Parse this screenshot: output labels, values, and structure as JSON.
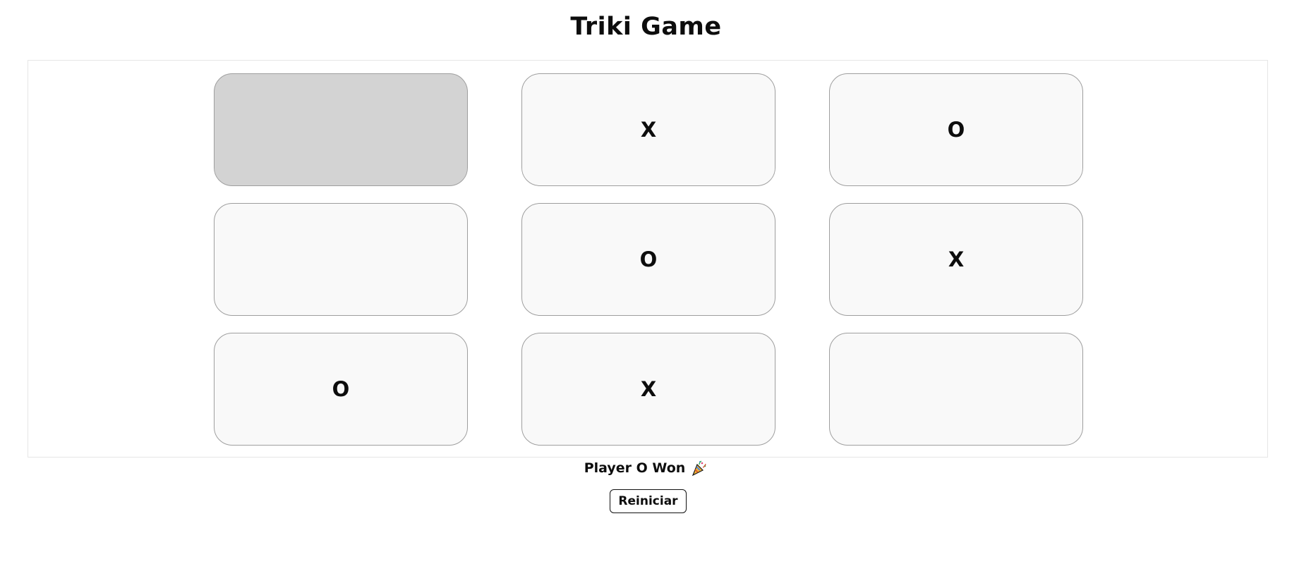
{
  "game": {
    "title": "Triki Game",
    "board": [
      [
        "",
        "X",
        "O"
      ],
      [
        "",
        "O",
        "X"
      ],
      [
        "O",
        "X",
        ""
      ]
    ],
    "hovered_cell": [
      0,
      0
    ],
    "status": "Player O Won",
    "status_icon": "party-popper-icon",
    "restart_label": "Reiniciar"
  },
  "colors": {
    "cell_background": "#f9f9f9",
    "cell_hover_background": "#d3d3d3",
    "cell_border": "#9e9e9e",
    "text": "#0d0d0d"
  }
}
